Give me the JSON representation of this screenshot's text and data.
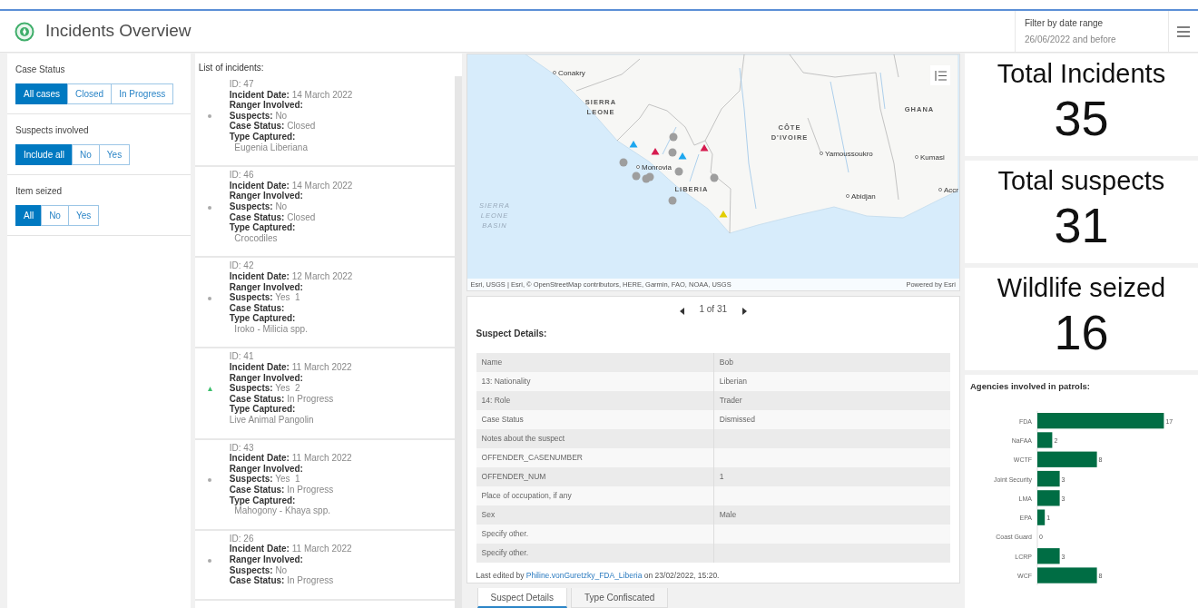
{
  "header": {
    "title": "Incidents Overview",
    "date_filter": {
      "label": "Filter by date range",
      "value": "26/06/2022 and before"
    }
  },
  "filters": [
    {
      "label": "Case Status",
      "options": [
        {
          "label": "All cases",
          "selected": true
        },
        {
          "label": "Closed",
          "selected": false
        },
        {
          "label": "In Progress",
          "selected": false
        }
      ]
    },
    {
      "label": "Suspects involved",
      "options": [
        {
          "label": "Include all",
          "selected": true
        },
        {
          "label": "No",
          "selected": false
        },
        {
          "label": "Yes",
          "selected": false
        }
      ]
    },
    {
      "label": "Item seized",
      "options": [
        {
          "label": "All",
          "selected": true
        },
        {
          "label": "No",
          "selected": false
        },
        {
          "label": "Yes",
          "selected": false
        }
      ]
    }
  ],
  "incident_list": {
    "title": "List of incidents:",
    "items": [
      {
        "kind": "dot",
        "lines": [
          "ID: 47",
          "**Incident Date:** 14 March 2022",
          "**Ranger Involved:**",
          "**Suspects:** No",
          "**Case Status:** Closed",
          "**Type Captured:**",
          "  Eugenia Liberiana"
        ]
      },
      {
        "kind": "dot",
        "lines": [
          "ID: 46",
          "**Incident Date:** 14 March 2022",
          "**Ranger Involved:**",
          "**Suspects:** No",
          "**Case Status:** Closed",
          "**Type Captured:**",
          "  Crocodiles"
        ]
      },
      {
        "kind": "dot",
        "lines": [
          "ID: 42",
          "**Incident Date:** 12 March 2022",
          "**Ranger Involved:**",
          "**Suspects:** Yes  1",
          "**Case Status:**",
          "**Type Captured:**",
          "  Iroko - Milicia spp."
        ]
      },
      {
        "kind": "triangle",
        "lines": [
          "ID: 41",
          "**Incident Date:** 11 March 2022",
          "**Ranger Involved:**",
          "**Suspects:** Yes  2",
          "**Case Status:** In Progress",
          "**Type Captured:**",
          "Live Animal Pangolin"
        ]
      },
      {
        "kind": "dot",
        "lines": [
          "ID: 43",
          "**Incident Date:** 11 March 2022",
          "**Ranger Involved:**",
          "**Suspects:** Yes  1",
          "**Case Status:** In Progress",
          "**Type Captured:**",
          "  Mahogony - Khaya spp."
        ]
      },
      {
        "kind": "dot",
        "lines": [
          "ID: 26",
          "**Incident Date:** 11 March 2022",
          "**Ranger Involved:**",
          "**Suspects:** No",
          "**Case Status:** In Progress"
        ]
      }
    ]
  },
  "map": {
    "labels": [
      {
        "kind": "city",
        "lines": [
          "Conakry"
        ]
      },
      {
        "kind": "country",
        "lines": [
          "SIERRA",
          "LEONE"
        ]
      },
      {
        "kind": "country",
        "lines": [
          "GHANA"
        ]
      },
      {
        "kind": "country",
        "lines": [
          "CÔTE",
          "D'IVOIRE"
        ]
      },
      {
        "kind": "city",
        "lines": [
          "Yamoussoukro"
        ]
      },
      {
        "kind": "city",
        "lines": [
          "Kumasi"
        ]
      },
      {
        "kind": "city",
        "lines": [
          "Monrovia"
        ]
      },
      {
        "kind": "country",
        "lines": [
          "LIBERIA"
        ]
      },
      {
        "kind": "city",
        "lines": [
          "Abidjan"
        ]
      },
      {
        "kind": "city",
        "lines": [
          "Accr"
        ]
      },
      {
        "kind": "sea",
        "lines": [
          "SIERRA",
          "LEONE",
          "BASIN"
        ]
      }
    ],
    "attribution": "Esri, USGS | Esri, © OpenStreetMap contributors, HERE, Garmin, FAO, NOAA, USGS",
    "powered_by": "Powered by Esri"
  },
  "details": {
    "pager": "1 of 31",
    "title": "Suspect Details:",
    "rows": [
      [
        "Name",
        "Bob"
      ],
      [
        "13: Nationality",
        "Liberian"
      ],
      [
        "14: Role",
        "Trader"
      ],
      [
        "Case Status",
        "Dismissed"
      ],
      [
        "Notes about the suspect",
        ""
      ],
      [
        "OFFENDER_CASENUMBER",
        ""
      ],
      [
        "OFFENDER_NUM",
        "1"
      ],
      [
        "Place of occupation, if any",
        ""
      ],
      [
        "Sex",
        "Male"
      ],
      [
        "Specify other.",
        ""
      ],
      [
        "Specify other.",
        ""
      ]
    ],
    "edited_prefix": "Last edited by ",
    "edited_user": "Philine.vonGuretzky_FDA_Liberia",
    "edited_suffix": " on 23/02/2022, 15:20.",
    "tabs": [
      {
        "label": "Suspect Details",
        "selected": true
      },
      {
        "label": "Type Confiscated",
        "selected": false
      }
    ]
  },
  "indicators": [
    {
      "title": "Total Incidents",
      "value": "35"
    },
    {
      "title": "Total suspects",
      "value": "31"
    },
    {
      "title": "Wildlife seized",
      "value": "16"
    }
  ],
  "agencies": {
    "title": "Agencies involved in patrols:",
    "chart_data": {
      "type": "bar",
      "orientation": "horizontal",
      "categories": [
        "FDA",
        "NaFAA",
        "WCTF",
        "Joint Security",
        "LMA",
        "EPA",
        "Coast Guard",
        "LCRP",
        "WCF"
      ],
      "series": [
        {
          "color": "#006d44",
          "values": [
            17,
            2,
            8,
            3,
            3,
            1,
            0,
            3,
            8
          ]
        }
      ],
      "data_labels": true
    }
  }
}
